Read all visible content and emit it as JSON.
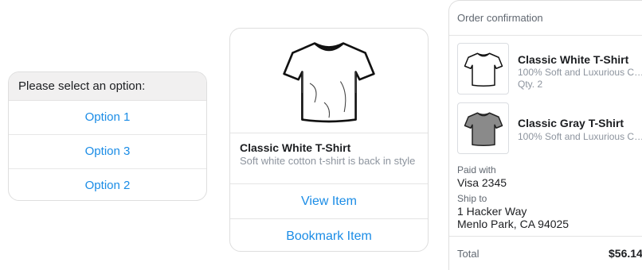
{
  "options_card": {
    "prompt": "Please select an option:",
    "options": [
      "Option 1",
      "Option 3",
      "Option 2"
    ]
  },
  "product_card": {
    "title": "Classic White T-Shirt",
    "subtitle": "Soft white cotton t-shirt is back in style",
    "buttons": [
      "View Item",
      "Bookmark Item"
    ],
    "image": "white-tshirt-icon"
  },
  "receipt": {
    "header": "Order confirmation",
    "items": [
      {
        "title": "Classic White T-Shirt",
        "subtitle": "100% Soft and Luxurious C…",
        "quantity": "Qty. 2",
        "image": "white-tshirt-icon"
      },
      {
        "title": "Classic Gray T-Shirt",
        "subtitle": "100% Soft and Luxurious C…",
        "image": "gray-tshirt-icon"
      }
    ],
    "paid_with_label": "Paid with",
    "paid_with_value": "Visa 2345",
    "ship_to_label": "Ship to",
    "ship_to_line1": "1 Hacker Way",
    "ship_to_line2": "Menlo Park, CA 94025",
    "total_label": "Total",
    "total_value": "$56.14"
  },
  "colors": {
    "accent_blue": "#1a8ce6",
    "header_gray": "#f1f0f0",
    "muted_text": "#8d949e",
    "shirt_gray": "#8a8a8a"
  }
}
